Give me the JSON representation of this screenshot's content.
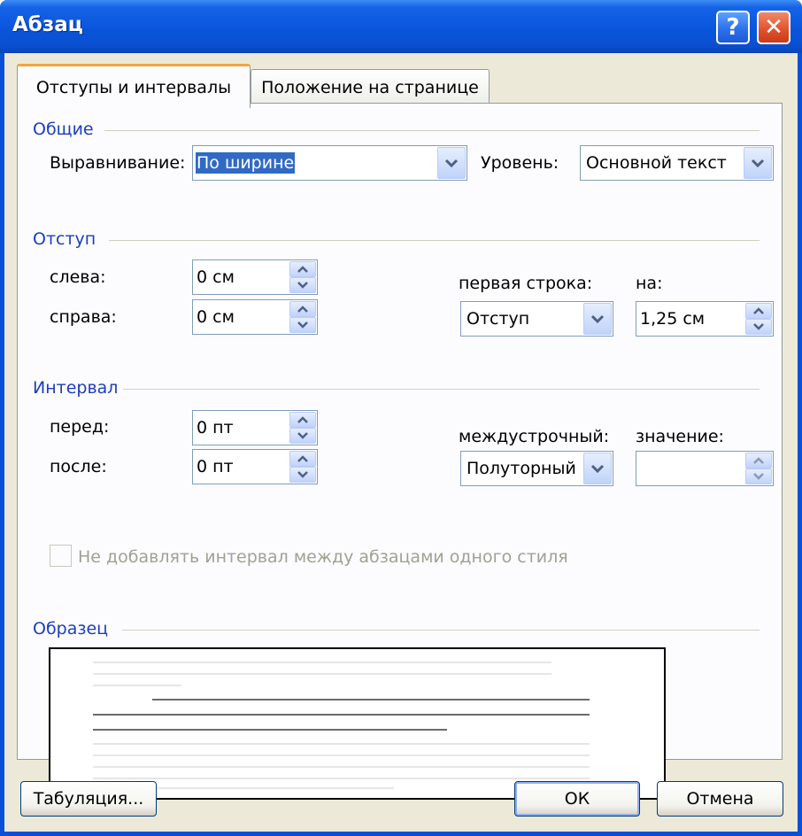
{
  "window": {
    "title": "Абзац",
    "help_label": "?",
    "close_label": "✕"
  },
  "tabs": [
    {
      "label": "Отступы и интервалы",
      "active": true
    },
    {
      "label": "Положение на странице",
      "active": false
    }
  ],
  "general": {
    "heading": "Общие",
    "alignment_label": "Выравнивание:",
    "alignment_value": "По ширине",
    "level_label": "Уровень:",
    "level_value": "Основной текст"
  },
  "indent": {
    "heading": "Отступ",
    "left_label": "слева:",
    "left_value": "0 см",
    "right_label": "справа:",
    "right_value": "0 см",
    "first_line_label": "первая строка:",
    "first_line_value": "Отступ",
    "by_label": "на:",
    "by_value": "1,25 см"
  },
  "spacing": {
    "heading": "Интервал",
    "before_label": "перед:",
    "before_value": "0 пт",
    "after_label": "после:",
    "after_value": "0 пт",
    "line_label": "междустрочный:",
    "line_value": "Полуторный",
    "at_label": "значение:",
    "at_value": "",
    "no_space_checkbox_label": "Не добавлять интервал между абзацами одного стиля",
    "no_space_checked": false
  },
  "preview": {
    "heading": "Образец"
  },
  "buttons": {
    "tabs_label": "Табуляция...",
    "ok_label": "ОК",
    "cancel_label": "Отмена"
  },
  "colors": {
    "title_bar": "#0a55dc",
    "section_heading": "#1c3fb8",
    "selection": "#316ac5",
    "dialog_bg": "#ece9d8"
  },
  "icons": {
    "dropdown": "chevron-down-icon",
    "spin_up": "arrow-up-icon",
    "spin_down": "arrow-down-icon"
  }
}
